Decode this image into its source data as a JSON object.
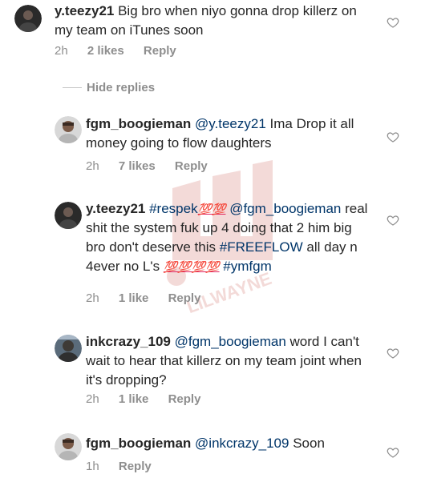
{
  "comments": [
    {
      "username": "y.teezy21",
      "text": "Big bro when niyo gonna drop killerz on my team on iTunes soon",
      "time": "2h",
      "likes": "2 likes",
      "reply": "Reply"
    },
    {
      "username": "fgm_boogieman",
      "mention": "@y.teezy21",
      "text": "Ima Drop it all money going to flow daughters",
      "time": "2h",
      "likes": "7 likes",
      "reply": "Reply"
    },
    {
      "username": "y.teezy21",
      "hashtag1": "#respek",
      "emoji_a": "💯💯",
      "mention": "@fgm_boogieman",
      "text_a": "real shit the system fuk up 4 doing that 2 him big bro don't deserve this",
      "hashtag2": "#FREEFLOW",
      "text_b": "all day n 4ever no L's",
      "emoji_b": "💯💯💯💯",
      "hashtag3": "#ymfgm",
      "time": "2h",
      "likes": "1 like",
      "reply": "Reply"
    },
    {
      "username": "inkcrazy_109",
      "mention": "@fgm_boogieman",
      "text": "word I can't wait to hear that killerz on my team joint when it's dropping?",
      "time": "2h",
      "likes": "1 like",
      "reply": "Reply"
    },
    {
      "username": "fgm_boogieman",
      "mention": "@inkcrazy_109",
      "text": "Soon",
      "time": "1h",
      "reply": "Reply"
    }
  ],
  "hide_replies": "Hide replies",
  "watermark_text": "LILWAYNE",
  "icons": {
    "like": "heart-outline-icon",
    "avatar": "user-avatar"
  },
  "colors": {
    "text": "#262626",
    "meta": "#8e8e8e",
    "link": "#003569",
    "background": "#ffffff"
  }
}
